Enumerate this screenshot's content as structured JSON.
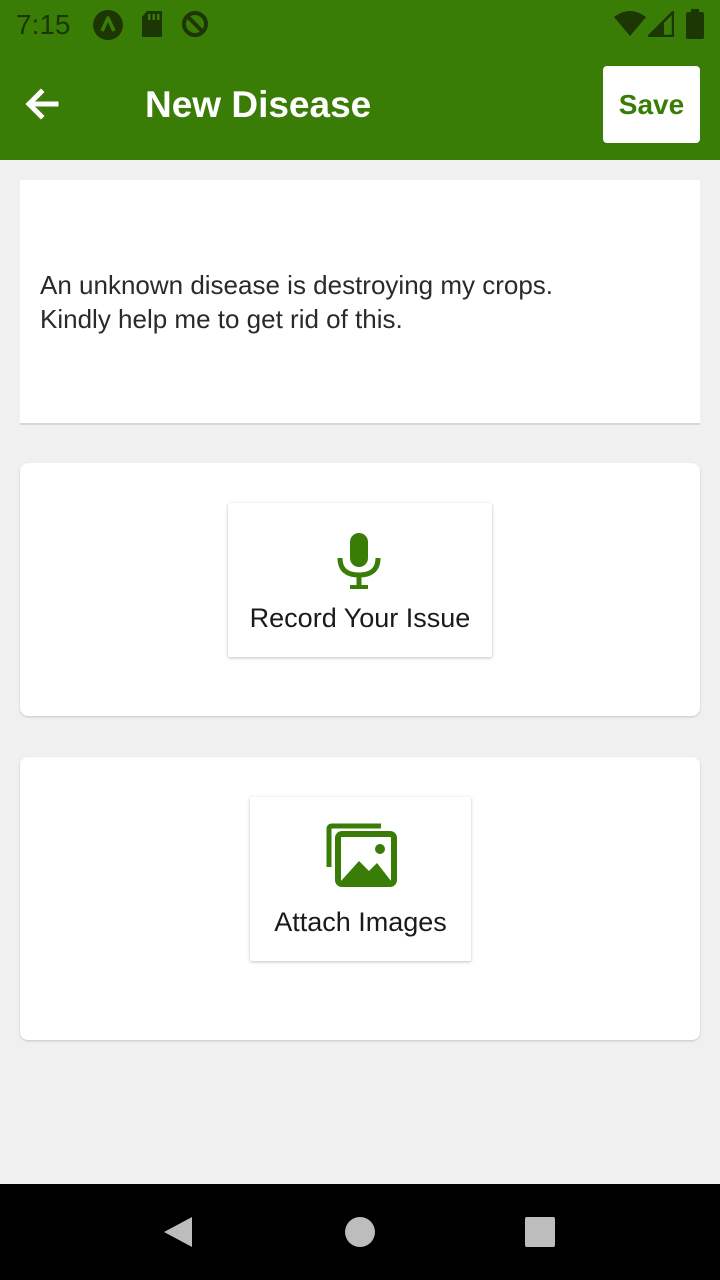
{
  "status_bar": {
    "time": "7:15",
    "left_icons": [
      "app-a-icon",
      "sd-card-icon",
      "sync-disabled-icon"
    ],
    "right_icons": [
      "wifi-icon",
      "cell-signal-icon",
      "battery-icon"
    ]
  },
  "app_bar": {
    "title": "New Disease",
    "back_icon": "arrow-back-icon",
    "save_label": "Save"
  },
  "description": {
    "text": "An unknown disease is destroying my crops.\nKindly help me to get rid of this."
  },
  "record": {
    "icon": "microphone-icon",
    "label": "Record Your Issue"
  },
  "attach": {
    "icon": "photo-library-icon",
    "label": "Attach Images"
  },
  "nav_bar": {
    "icons": [
      "back-triangle-icon",
      "home-circle-icon",
      "recents-square-icon"
    ]
  },
  "colors": {
    "primary": "#3a7d06",
    "background": "#f0f0f0",
    "card": "#ffffff",
    "nav": "#000000"
  }
}
